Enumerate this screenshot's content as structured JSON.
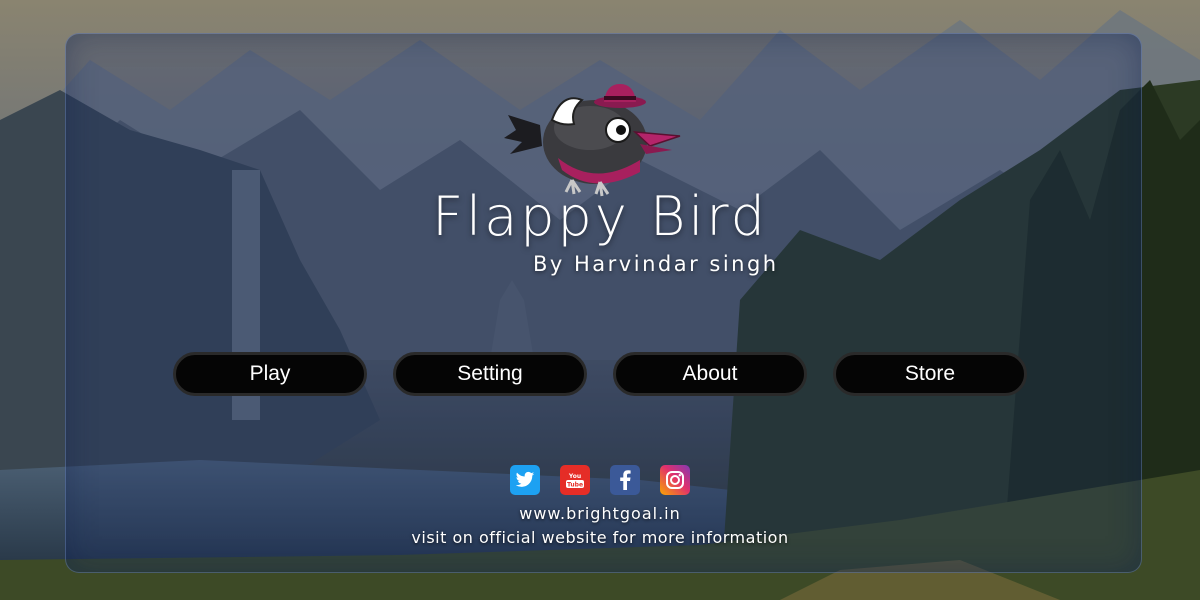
{
  "game": {
    "title": "Flappy Bird",
    "byline": "By Harvindar singh"
  },
  "menu": {
    "play_label": "Play",
    "setting_label": "Setting",
    "about_label": "About",
    "store_label": "Store"
  },
  "social": {
    "icons": [
      "twitter-icon",
      "youtube-icon",
      "facebook-icon",
      "instagram-icon"
    ]
  },
  "footer": {
    "website": "www.brightgoal.in",
    "info_text": "visit on official website for more information"
  },
  "colors": {
    "button_bg": "#050505",
    "panel_tint": "#182e6e",
    "bird_body": "#3a3a3e",
    "bird_accent": "#a8205e"
  }
}
